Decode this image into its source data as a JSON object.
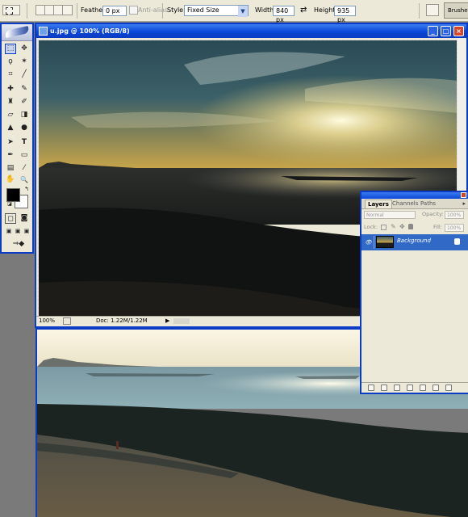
{
  "options_bar": {
    "feather_label": "Feather:",
    "feather_value": "0 px",
    "antialias_label": "Anti-alias",
    "style_label": "Style:",
    "style_value": "Fixed Size",
    "width_label": "Width:",
    "width_value": "840 px",
    "height_label": "Height:",
    "height_value": "935 px",
    "swap_glyph": "⇄",
    "palette_tab": "Brushes"
  },
  "document": {
    "title": "u.jpg @ 100% (RGB/8)",
    "zoom": "100%",
    "doc_size": "Doc: 1.22M/1.22M"
  },
  "layers_panel": {
    "tabs": [
      "Layers",
      "Channels",
      "Paths"
    ],
    "blend_mode": "Normal",
    "opacity_label": "Opacity:",
    "opacity_value": "100%",
    "lock_label": "Lock:",
    "fill_label": "Fill:",
    "fill_value": "100%",
    "layer_name": "Background"
  },
  "colors": {
    "window_frame": "#0a3cc6",
    "panel_bg": "#ece9d8",
    "layer_selected": "#3169c6",
    "foreground_color": "#000000",
    "background_color": "#ffffff"
  },
  "toolbox": {
    "tools": [
      "marquee",
      "move",
      "lasso",
      "magic-wand",
      "crop",
      "slice",
      "healing-brush",
      "brush",
      "clone-stamp",
      "history-brush",
      "eraser",
      "gradient",
      "blur",
      "dodge",
      "pen",
      "type",
      "path-selection",
      "shape",
      "notes",
      "eyedropper",
      "hand",
      "zoom"
    ],
    "type_glyph": "T",
    "zoom_glyph": "🔍",
    "hand_glyph": "✋"
  }
}
